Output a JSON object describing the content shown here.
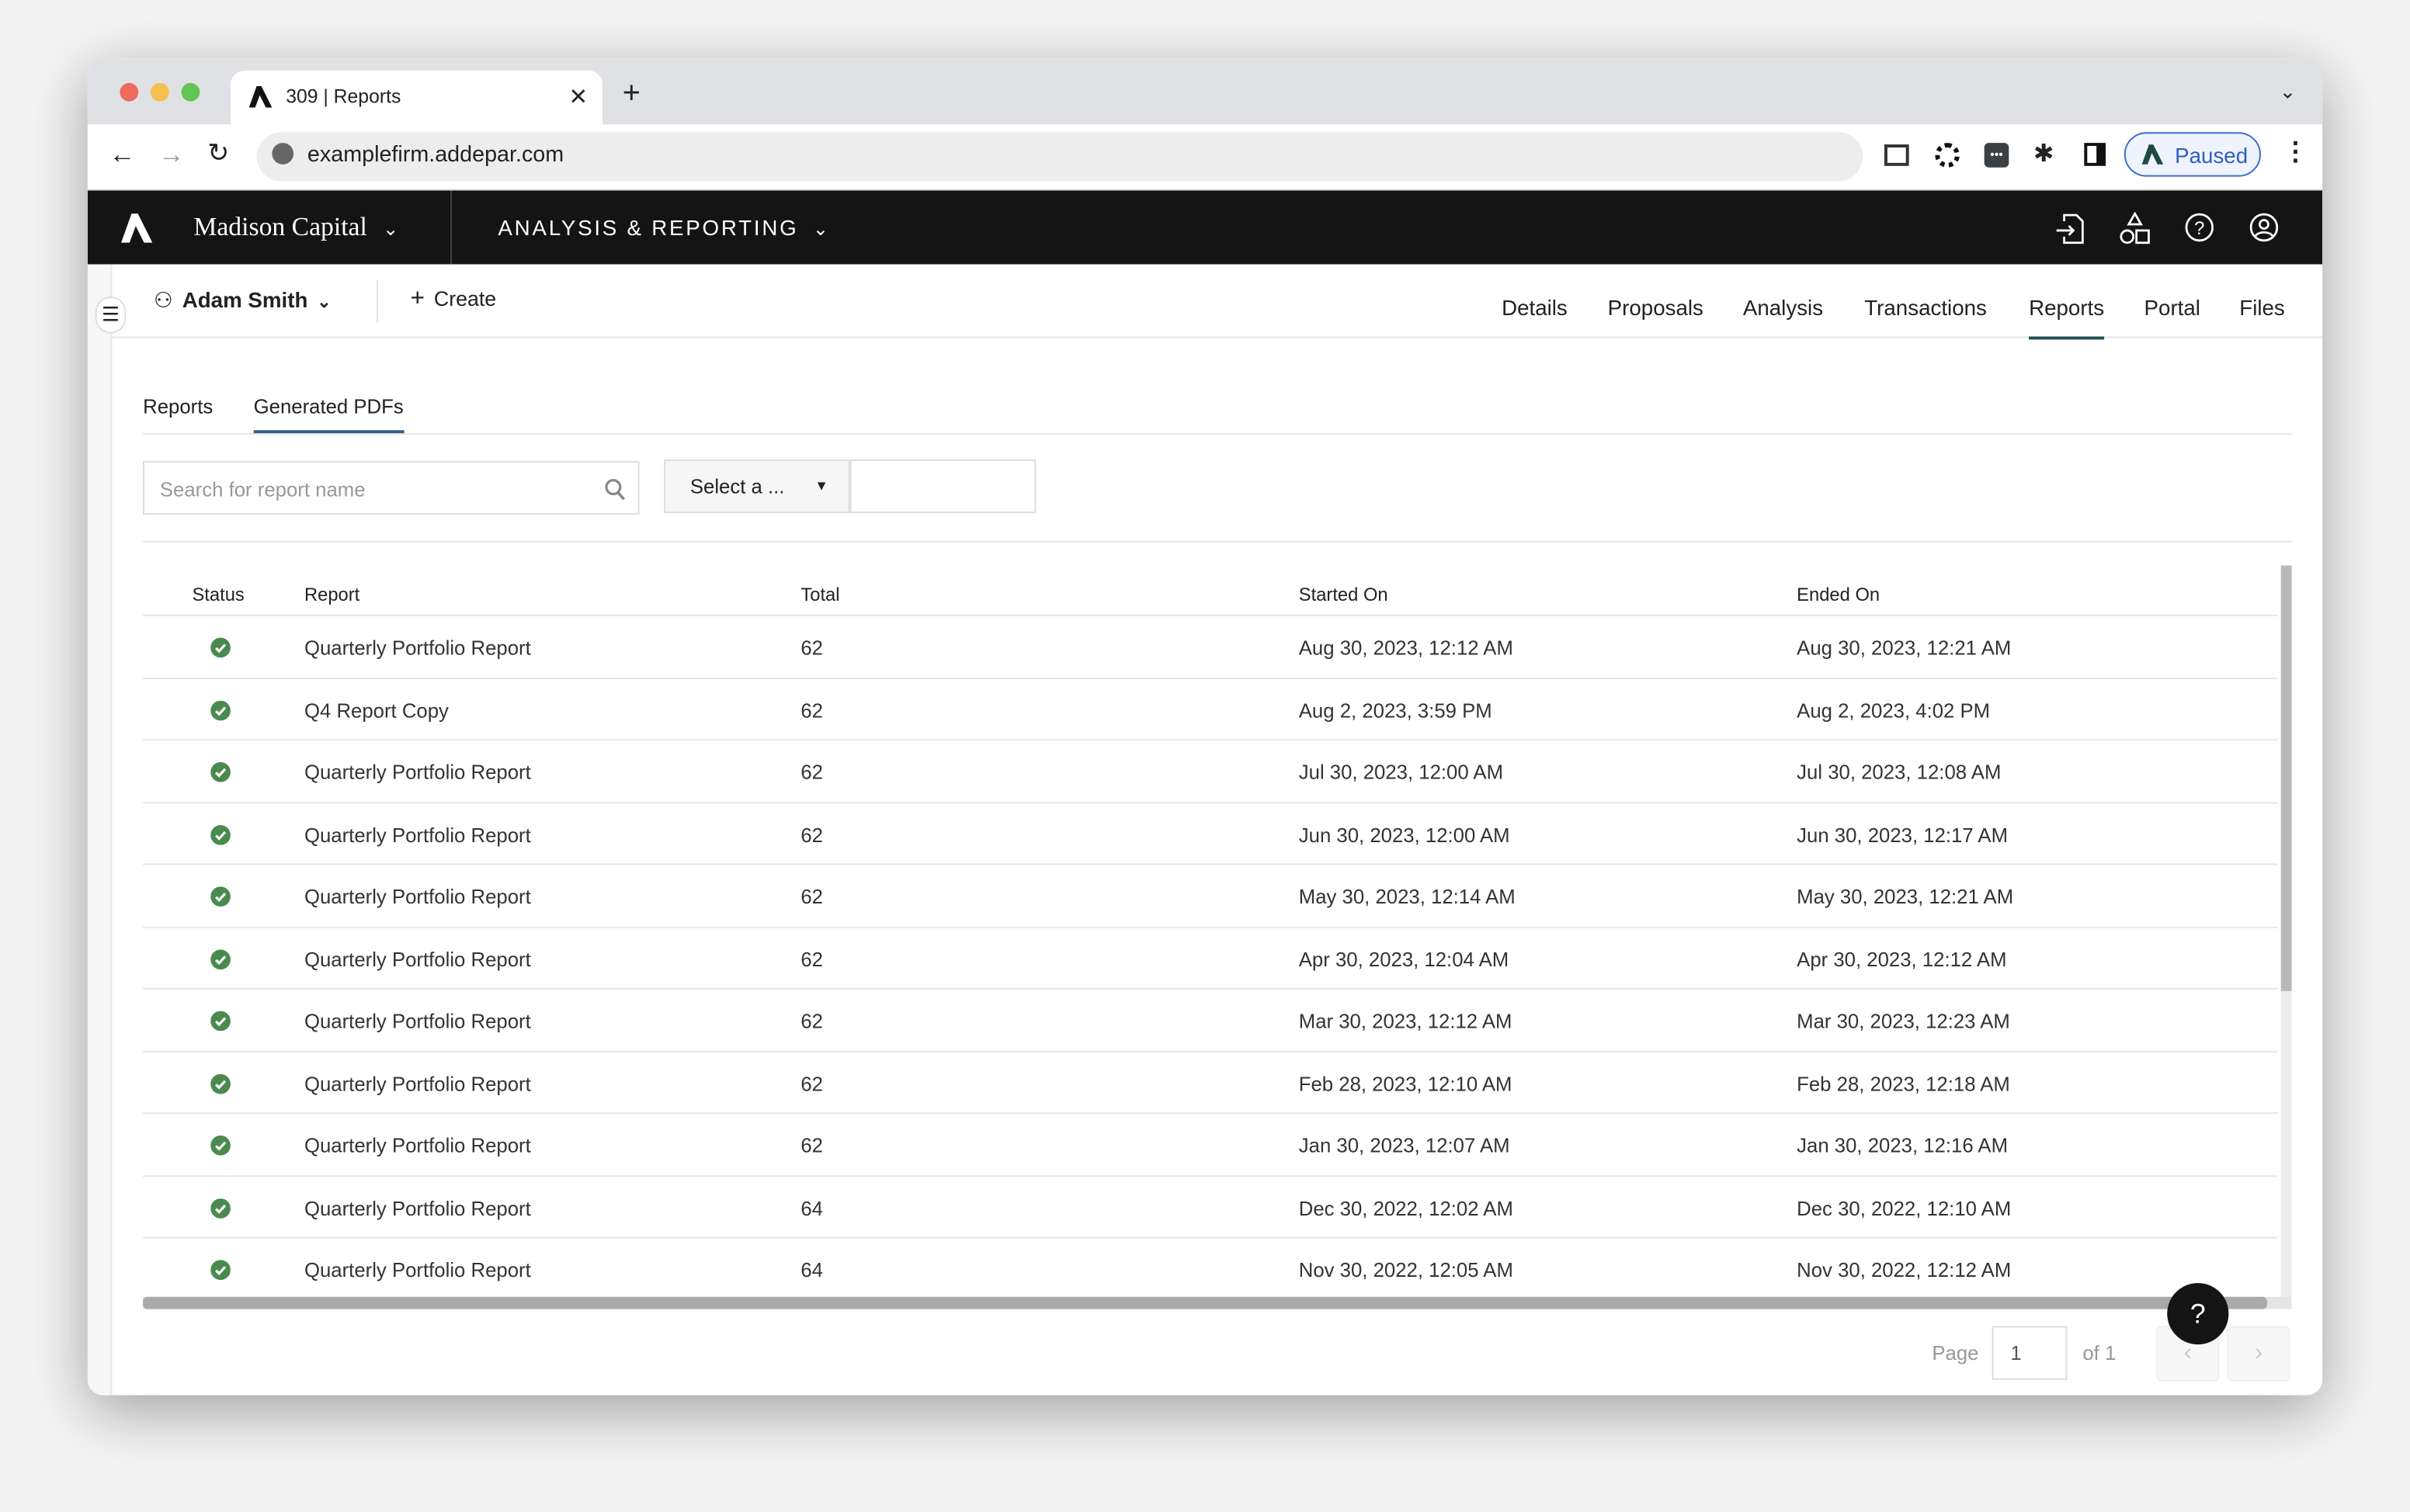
{
  "browser": {
    "tab_title": "309 | Reports",
    "url": "examplefirm.addepar.com",
    "profile_label": "Paused"
  },
  "header": {
    "firm": "Madison Capital",
    "module": "ANALYSIS & REPORTING"
  },
  "subheader": {
    "user": "Adam Smith",
    "create_label": "Create",
    "nav": [
      {
        "label": "Details"
      },
      {
        "label": "Proposals"
      },
      {
        "label": "Analysis"
      },
      {
        "label": "Transactions"
      },
      {
        "label": "Reports",
        "active": true
      },
      {
        "label": "Portal"
      },
      {
        "label": "Files"
      }
    ]
  },
  "subtabs": [
    {
      "label": "Reports"
    },
    {
      "label": "Generated PDFs",
      "active": true
    }
  ],
  "filters": {
    "search_placeholder": "Search for report name",
    "select_label": "Select a ...",
    "extra_value": ""
  },
  "table": {
    "columns": [
      "Status",
      "Report",
      "Total",
      "Started On",
      "Ended On"
    ],
    "rows": [
      {
        "status": "success",
        "report": "Quarterly Portfolio Report",
        "total": "62",
        "started": "Aug 30, 2023, 12:12 AM",
        "ended": "Aug 30, 2023, 12:21 AM"
      },
      {
        "status": "success",
        "report": "Q4 Report Copy",
        "total": "62",
        "started": "Aug 2, 2023, 3:59 PM",
        "ended": "Aug 2, 2023, 4:02 PM"
      },
      {
        "status": "success",
        "report": "Quarterly Portfolio Report",
        "total": "62",
        "started": "Jul 30, 2023, 12:00 AM",
        "ended": "Jul 30, 2023, 12:08 AM"
      },
      {
        "status": "success",
        "report": "Quarterly Portfolio Report",
        "total": "62",
        "started": "Jun 30, 2023, 12:00 AM",
        "ended": "Jun 30, 2023, 12:17 AM"
      },
      {
        "status": "success",
        "report": "Quarterly Portfolio Report",
        "total": "62",
        "started": "May 30, 2023, 12:14 AM",
        "ended": "May 30, 2023, 12:21 AM"
      },
      {
        "status": "success",
        "report": "Quarterly Portfolio Report",
        "total": "62",
        "started": "Apr 30, 2023, 12:04 AM",
        "ended": "Apr 30, 2023, 12:12 AM"
      },
      {
        "status": "success",
        "report": "Quarterly Portfolio Report",
        "total": "62",
        "started": "Mar 30, 2023, 12:12 AM",
        "ended": "Mar 30, 2023, 12:23 AM"
      },
      {
        "status": "success",
        "report": "Quarterly Portfolio Report",
        "total": "62",
        "started": "Feb 28, 2023, 12:10 AM",
        "ended": "Feb 28, 2023, 12:18 AM"
      },
      {
        "status": "success",
        "report": "Quarterly Portfolio Report",
        "total": "62",
        "started": "Jan 30, 2023, 12:07 AM",
        "ended": "Jan 30, 2023, 12:16 AM"
      },
      {
        "status": "success",
        "report": "Quarterly Portfolio Report",
        "total": "64",
        "started": "Dec 30, 2022, 12:02 AM",
        "ended": "Dec 30, 2022, 12:10 AM"
      },
      {
        "status": "success",
        "report": "Quarterly Portfolio Report",
        "total": "64",
        "started": "Nov 30, 2022, 12:05 AM",
        "ended": "Nov 30, 2022, 12:12 AM"
      }
    ]
  },
  "pagination": {
    "page_label": "Page",
    "page_value": "1",
    "of_label": "of 1"
  },
  "help_label": "?",
  "colors": {
    "success": "#4a8a4f",
    "active_nav": "#1f4f4f",
    "active_subtab": "#2f5b85",
    "header_bg": "#141414"
  }
}
